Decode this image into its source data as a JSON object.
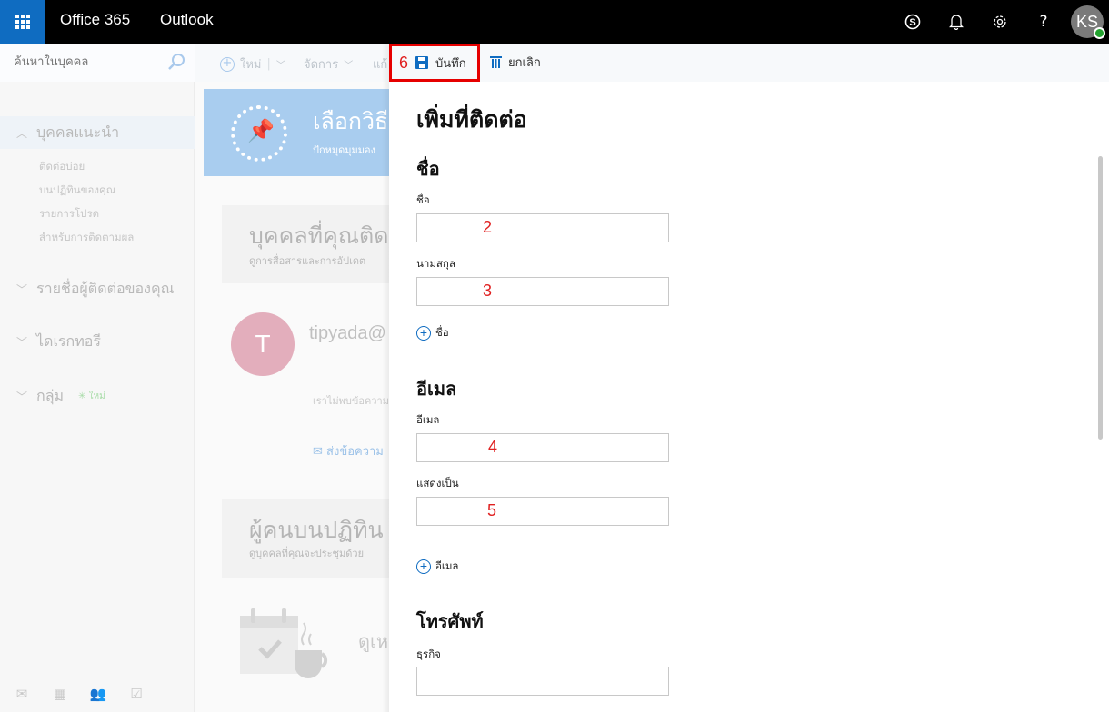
{
  "topbar": {
    "brand": "Office 365",
    "app": "Outlook",
    "icons": [
      "skype-icon",
      "bell-icon",
      "gear-icon",
      "help-icon"
    ],
    "help_glyph": "?",
    "avatar_initials": "KS",
    "presence_color": "#22a32f",
    "accent": "#0f6cc1"
  },
  "left_nav": {
    "search_placeholder": "ค้นหาในบุคคล",
    "sections": [
      {
        "label": "บุคคลแนะนำ",
        "expanded": true,
        "items": [
          "ติดต่อบ่อย",
          "บนปฏิทินของคุณ",
          "รายการโปรด",
          "สำหรับการติดตามผล"
        ]
      },
      {
        "label": "รายชื่อผู้ติดต่อของคุณ",
        "expanded": false
      },
      {
        "label": "ไดเรกทอรี",
        "expanded": false
      },
      {
        "label": "กลุ่ม",
        "expanded": false,
        "badge": "ใหม่"
      }
    ],
    "bottom_icons": [
      "mail-icon",
      "calendar-icon",
      "people-icon",
      "tasks-icon"
    ]
  },
  "toolbar": {
    "new_label": "ใหม่",
    "manage_label": "จัดการ",
    "edit_label": "แก้",
    "save_label": "บันทึก",
    "save_step": "6",
    "cancel_label": "ยกเลิก"
  },
  "background": {
    "banner_title": "เลือกวิธี",
    "banner_subtitle": "ปักหมุดมุมมอง",
    "card1_title": "บุคคลที่คุณติด",
    "card1_subtitle": "ดูการสื่อสารและการอัปเดต",
    "contact_initial": "T",
    "contact_email": "tipyada@",
    "no_messages": "เราไม่พบข้อความ",
    "send_message": "ส่งข้อความ",
    "card2_title": "ผู้คนบนปฏิทิน",
    "card2_subtitle": "ดูบุคคลที่คุณจะประชุมด้วย",
    "see_text": "ดูเห"
  },
  "form": {
    "title": "เพิ่มที่ติดต่อ",
    "name_section": "ชื่อ",
    "first_name_label": "ชื่อ",
    "first_name_value": "",
    "first_name_step": "2",
    "last_name_label": "นามสกุล",
    "last_name_value": "",
    "last_name_step": "3",
    "add_name_label": "ชื่อ",
    "email_section": "อีเมล",
    "email_label": "อีเมล",
    "email_value": "",
    "email_step": "4",
    "display_as_label": "แสดงเป็น",
    "display_as_value": "",
    "display_as_step": "5",
    "add_email_label": "อีเมล",
    "phone_section": "โทรศัพท์",
    "business_label": "ธุรกิจ",
    "business_value": ""
  }
}
